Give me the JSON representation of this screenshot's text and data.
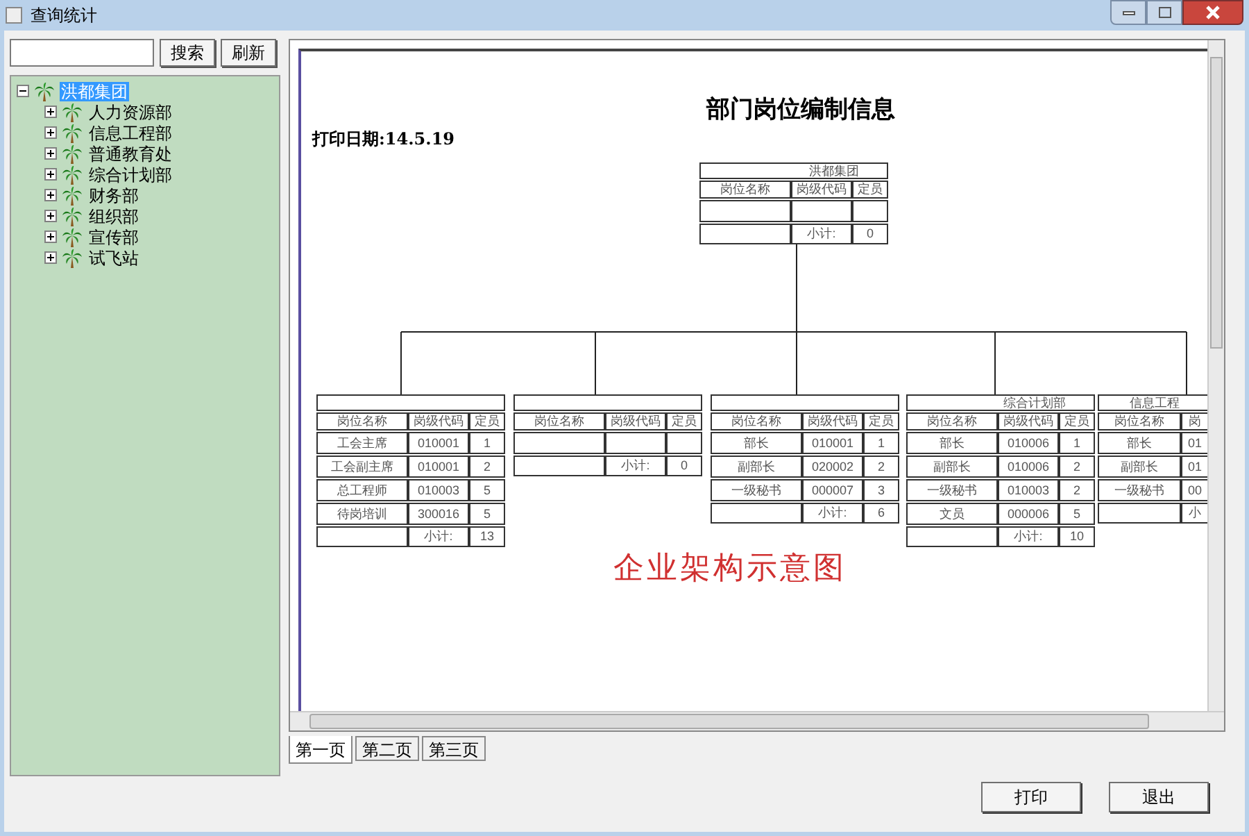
{
  "window": {
    "title": "查询统计"
  },
  "search": {
    "buttons": [
      "搜索",
      "刷新"
    ]
  },
  "tree": {
    "label": "洪都集团",
    "expanded": true,
    "selected": true,
    "children": [
      {
        "label": "人力资源部",
        "expanded": false,
        "selected": false
      },
      {
        "label": "信息工程部",
        "expanded": false,
        "selected": false
      },
      {
        "label": "普通教育处",
        "expanded": false,
        "selected": false
      },
      {
        "label": "综合计划部",
        "expanded": false,
        "selected": false
      },
      {
        "label": "财务部",
        "expanded": false,
        "selected": false
      },
      {
        "label": "组织部",
        "expanded": false,
        "selected": false
      },
      {
        "label": "宣传部",
        "expanded": false,
        "selected": false
      },
      {
        "label": "试飞站",
        "expanded": false,
        "selected": false
      }
    ]
  },
  "report": {
    "title": "部门岗位编制信息",
    "print_date": "打印日期:14.5.19",
    "root_unit": {
      "title": "洪都集团",
      "headers": [
        "岗位名称",
        "岗级代码",
        "定员"
      ],
      "rows": [
        []
      ],
      "subtotal_label": "小计:",
      "subtotal": "0"
    },
    "units": [
      {
        "headers": [
          "岗位名称",
          "岗级代码",
          "定员"
        ],
        "rows": [
          [
            "工会主席",
            "010001",
            "1"
          ],
          [
            "工会副主席",
            "010001",
            "2"
          ],
          [
            "总工程师",
            "010003",
            "5"
          ],
          [
            "待岗培训",
            "300016",
            "5"
          ]
        ],
        "subtotal_label": "小计:",
        "subtotal": "13"
      },
      {
        "headers": [
          "岗位名称",
          "岗级代码",
          "定员"
        ],
        "rows": [
          []
        ],
        "subtotal_label": "小计:",
        "subtotal": "0"
      },
      {
        "headers": [
          "岗位名称",
          "岗级代码",
          "定员"
        ],
        "rows": [
          [
            "部长",
            "010001",
            "1"
          ],
          [
            "副部长",
            "020002",
            "2"
          ],
          [
            "一级秘书",
            "000007",
            "3"
          ]
        ],
        "subtotal_label": "小计:",
        "subtotal": "6"
      },
      {
        "title": "综合计划部",
        "headers": [
          "岗位名称",
          "岗级代码",
          "定员"
        ],
        "rows": [
          [
            "部长",
            "010006",
            "1"
          ],
          [
            "副部长",
            "010006",
            "2"
          ],
          [
            "一级秘书",
            "010003",
            "2"
          ],
          [
            "文员",
            "000006",
            "5"
          ]
        ],
        "subtotal_label": "小计:",
        "subtotal": "10"
      },
      {
        "title": "信息工程",
        "headers": [
          "岗位名称",
          "岗"
        ],
        "rows": [
          [
            "部长",
            "01"
          ],
          [
            "副部长",
            "01"
          ],
          [
            "一级秘书",
            "00"
          ]
        ],
        "subtotal_label": "小"
      }
    ],
    "annotation": "企业架构示意图"
  },
  "tabs": [
    {
      "label": "第一页",
      "selected": true
    },
    {
      "label": "第二页",
      "selected": false
    },
    {
      "label": "第三页",
      "selected": false
    }
  ],
  "buttons": [
    "打印",
    "退出"
  ]
}
